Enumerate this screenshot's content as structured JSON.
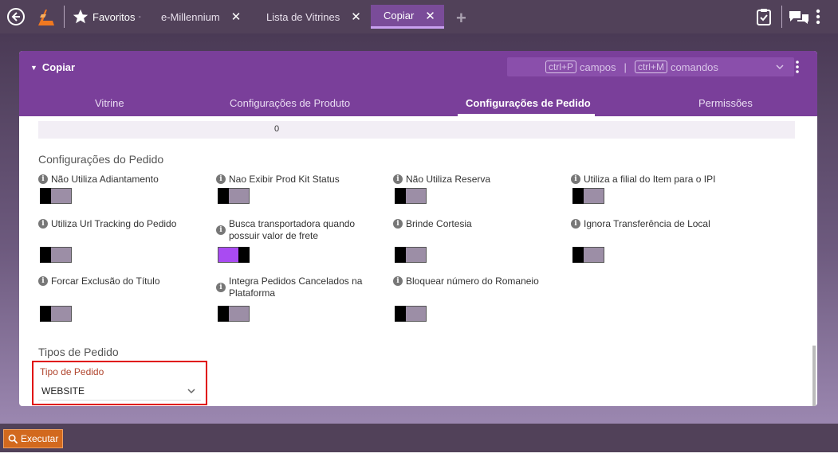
{
  "topbar": {
    "favorites_label": "Favoritos",
    "favorites_caret": "-",
    "tabs": [
      {
        "label": "e-Millennium",
        "close": "✕"
      },
      {
        "label": "Lista de Vitrines",
        "close": "✕"
      },
      {
        "label": "Copiar",
        "close": "✕"
      }
    ],
    "add_tab": "+",
    "icons": [
      "back-icon",
      "logo-icon",
      "star-icon",
      "clipboard-check-icon",
      "chat-icon",
      "kebab-icon"
    ]
  },
  "card": {
    "title": "Copiar",
    "shortcuts": {
      "key1": "ctrl+P",
      "label1": "campos",
      "separator": "|",
      "key2": "ctrl+M",
      "label2": "comandos"
    },
    "tabs": [
      {
        "label": "Vitrine"
      },
      {
        "label": "Configurações de Produto"
      },
      {
        "label": "Configurações de Pedido"
      },
      {
        "label": "Permissões"
      }
    ],
    "active_tab": "Configurações de Pedido"
  },
  "body": {
    "zero_value": "0",
    "section_pedido": "Configurações do Pedido",
    "options": [
      {
        "label": "Não Utiliza Adiantamento",
        "state": "off"
      },
      {
        "label": "Nao Exibir Prod Kit Status",
        "state": "off"
      },
      {
        "label": "Não Utiliza Reserva",
        "state": "off"
      },
      {
        "label": "Utiliza a filial do Item para o IPI",
        "state": "off"
      },
      {
        "label": "Utiliza Url Tracking do Pedido",
        "state": "off"
      },
      {
        "label": "Busca transportadora quando possuir valor de frete",
        "state": "on"
      },
      {
        "label": "Brinde Cortesia",
        "state": "off"
      },
      {
        "label": "Ignora Transferência de Local",
        "state": "off"
      },
      {
        "label": "Forcar Exclusão do Título",
        "state": "off"
      },
      {
        "label": "Integra Pedidos Cancelados na Plataforma",
        "state": "off"
      },
      {
        "label": "Bloquear número do Romaneio",
        "state": "off"
      }
    ],
    "section_tipos": "Tipos de Pedido",
    "tipo_label": "Tipo de Pedido",
    "tipo_value": "WEBSITE"
  },
  "bottombar": {
    "execute_label": "Executar"
  },
  "colors": {
    "topbar": "#514159",
    "card_header": "#7a3f9a",
    "toggle_on": "#a94bf2",
    "highlight_border": "#e00000",
    "execute_button": "#d2691e"
  }
}
